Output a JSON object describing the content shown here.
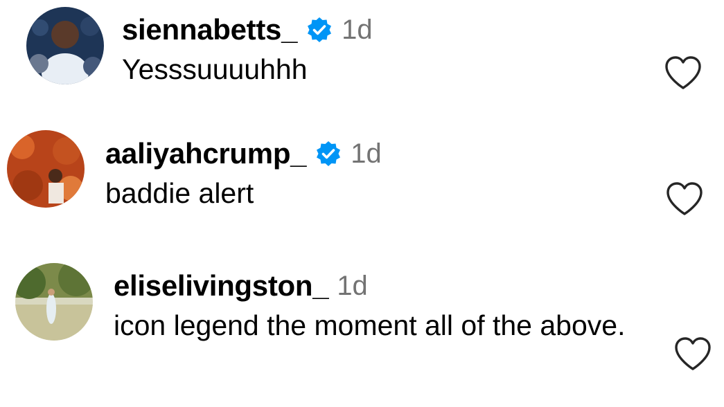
{
  "comments": [
    {
      "username": "siennabetts_",
      "verified": true,
      "time": "1d",
      "text": "Yesssuuuuhhh",
      "avatar_colors": [
        "#1e3556",
        "#6a7890"
      ]
    },
    {
      "username": "aaliyahcrump_",
      "verified": true,
      "time": "1d",
      "text": "baddie alert",
      "avatar_colors": [
        "#b8441a",
        "#e07a3a"
      ]
    },
    {
      "username": "eliselivingston_",
      "verified": false,
      "time": "1d",
      "text": "icon legend the moment all of the above.",
      "avatar_colors": [
        "#9aa06a",
        "#d9d8c0"
      ]
    }
  ],
  "icons": {
    "verified": "verified-badge-icon",
    "like": "heart-outline-icon"
  },
  "colors": {
    "verified_blue": "#0095f6",
    "timestamp_gray": "#737373",
    "heart_stroke": "#262626"
  }
}
